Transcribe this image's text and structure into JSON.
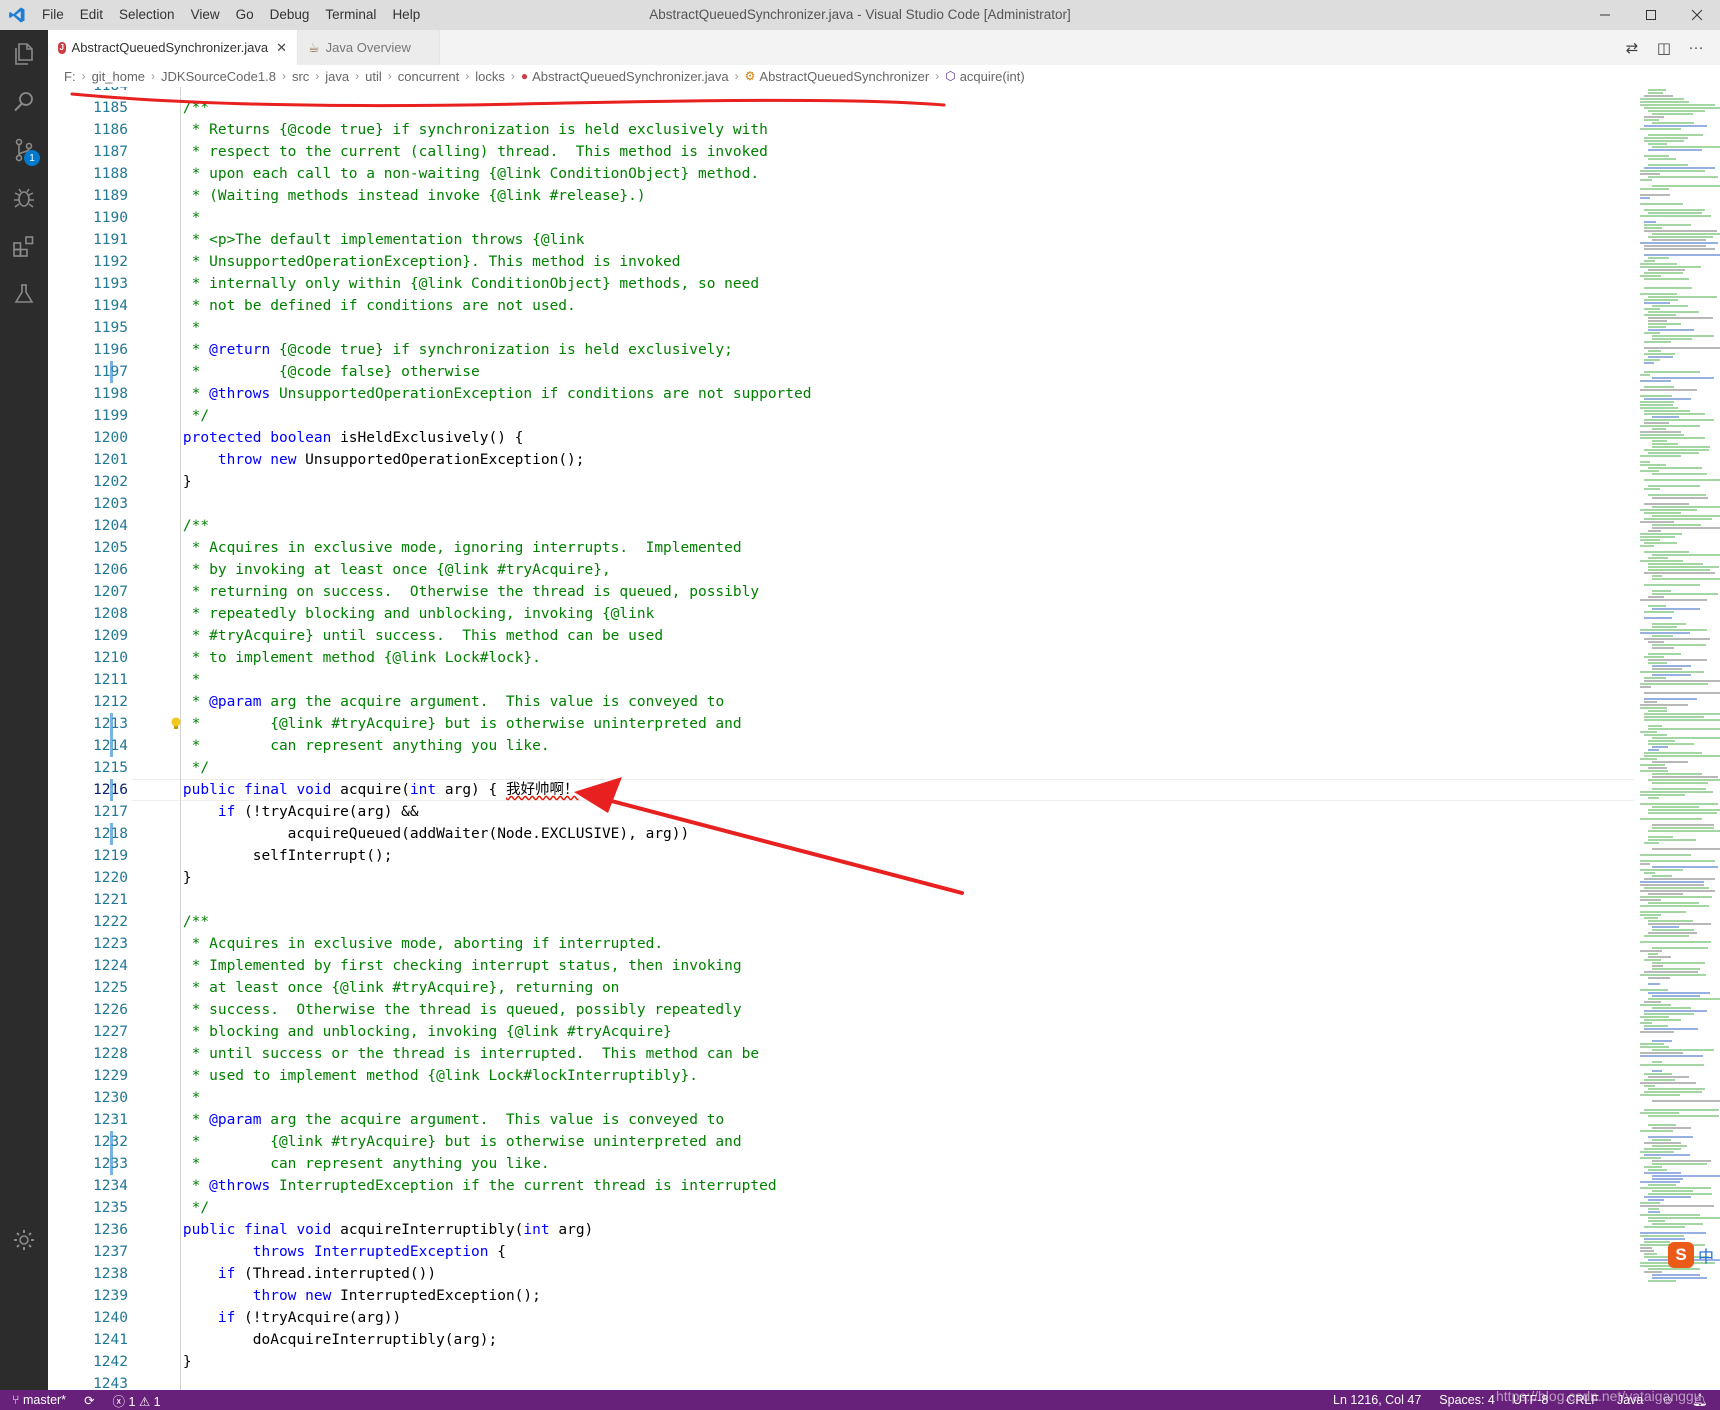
{
  "window": {
    "title": "AbstractQueuedSynchronizer.java - Visual Studio Code [Administrator]",
    "menu": [
      "File",
      "Edit",
      "Selection",
      "View",
      "Go",
      "Debug",
      "Terminal",
      "Help"
    ],
    "controls": [
      "minimize",
      "maximize",
      "close"
    ]
  },
  "activity_bar": {
    "items": [
      {
        "name": "explorer-icon"
      },
      {
        "name": "search-icon"
      },
      {
        "name": "source-control-icon",
        "badge": "1"
      },
      {
        "name": "debug-icon"
      },
      {
        "name": "extensions-icon"
      },
      {
        "name": "test-flask-icon"
      }
    ],
    "manage": "gear-icon"
  },
  "tabs": [
    {
      "label": "AbstractQueuedSynchronizer.java",
      "active": true,
      "icon": "java-file-icon"
    },
    {
      "label": "Java Overview",
      "active": false,
      "icon": "java-overview-icon"
    }
  ],
  "breadcrumb": [
    "F:",
    "git_home",
    "JDKSourceCode1.8",
    "src",
    "java",
    "util",
    "concurrent",
    "locks",
    "AbstractQueuedSynchronizer.java",
    "AbstractQueuedSynchronizer",
    "acquire(int)"
  ],
  "editor": {
    "first_line_partial": "1184",
    "current_line": 1216,
    "lines": [
      {
        "n": "1185",
        "t": [
          [
            "cm",
            "    /**"
          ]
        ]
      },
      {
        "n": "1186",
        "t": [
          [
            "cm",
            "     * Returns {@code true} if synchronization is held exclusively with"
          ]
        ]
      },
      {
        "n": "1187",
        "t": [
          [
            "cm",
            "     * respect to the current (calling) thread.  This method is invoked"
          ]
        ]
      },
      {
        "n": "1188",
        "t": [
          [
            "cm",
            "     * upon each call to a non-waiting {@link ConditionObject} method."
          ]
        ]
      },
      {
        "n": "1189",
        "t": [
          [
            "cm",
            "     * (Waiting methods instead invoke {@link #release}.)"
          ]
        ]
      },
      {
        "n": "1190",
        "t": [
          [
            "cm",
            "     *"
          ]
        ]
      },
      {
        "n": "1191",
        "t": [
          [
            "cm",
            "     * <p>The default implementation throws {@link"
          ]
        ]
      },
      {
        "n": "1192",
        "t": [
          [
            "cm",
            "     * UnsupportedOperationException}. This method is invoked"
          ]
        ]
      },
      {
        "n": "1193",
        "t": [
          [
            "cm",
            "     * internally only within {@link ConditionObject} methods, so need"
          ]
        ]
      },
      {
        "n": "1194",
        "t": [
          [
            "cm",
            "     * not be defined if conditions are not used."
          ]
        ]
      },
      {
        "n": "1195",
        "t": [
          [
            "cm",
            "     *"
          ]
        ]
      },
      {
        "n": "1196",
        "t": [
          [
            "cm",
            "     * "
          ],
          [
            "tag",
            "@return"
          ],
          [
            "cm",
            " {@code true} if synchronization is held exclusively;"
          ]
        ]
      },
      {
        "n": "1197",
        "t": [
          [
            "cm",
            "     *         {@code false} otherwise"
          ]
        ]
      },
      {
        "n": "1198",
        "t": [
          [
            "cm",
            "     * "
          ],
          [
            "tag",
            "@throws"
          ],
          [
            "cm",
            " UnsupportedOperationException if conditions are not supported"
          ]
        ]
      },
      {
        "n": "1199",
        "t": [
          [
            "cm",
            "     */"
          ]
        ]
      },
      {
        "n": "1200",
        "t": [
          [
            "kw",
            "    protected"
          ],
          [
            "pl",
            " "
          ],
          [
            "kw",
            "boolean"
          ],
          [
            "pl",
            " isHeldExclusively() {"
          ]
        ]
      },
      {
        "n": "1201",
        "t": [
          [
            "kw",
            "        throw"
          ],
          [
            "pl",
            " "
          ],
          [
            "kw",
            "new"
          ],
          [
            "pl",
            " UnsupportedOperationException();"
          ]
        ]
      },
      {
        "n": "1202",
        "t": [
          [
            "pl",
            "    }"
          ]
        ]
      },
      {
        "n": "1203",
        "t": []
      },
      {
        "n": "1204",
        "t": [
          [
            "cm",
            "    /**"
          ]
        ]
      },
      {
        "n": "1205",
        "t": [
          [
            "cm",
            "     * Acquires in exclusive mode, ignoring interrupts.  Implemented"
          ]
        ]
      },
      {
        "n": "1206",
        "t": [
          [
            "cm",
            "     * by invoking at least once {@link #tryAcquire},"
          ]
        ]
      },
      {
        "n": "1207",
        "t": [
          [
            "cm",
            "     * returning on success.  Otherwise the thread is queued, possibly"
          ]
        ]
      },
      {
        "n": "1208",
        "t": [
          [
            "cm",
            "     * repeatedly blocking and unblocking, invoking {@link"
          ]
        ]
      },
      {
        "n": "1209",
        "t": [
          [
            "cm",
            "     * #tryAcquire} until success.  This method can be used"
          ]
        ]
      },
      {
        "n": "1210",
        "t": [
          [
            "cm",
            "     * to implement method {@link Lock#lock}."
          ]
        ]
      },
      {
        "n": "1211",
        "t": [
          [
            "cm",
            "     *"
          ]
        ]
      },
      {
        "n": "1212",
        "t": [
          [
            "cm",
            "     * "
          ],
          [
            "tag",
            "@param"
          ],
          [
            "cm",
            " arg the acquire argument.  This value is conveyed to"
          ]
        ]
      },
      {
        "n": "1213",
        "t": [
          [
            "cm",
            "     *        {@link #tryAcquire} but is otherwise uninterpreted and"
          ]
        ]
      },
      {
        "n": "1214",
        "t": [
          [
            "cm",
            "     *        can represent anything you like."
          ]
        ]
      },
      {
        "n": "1215",
        "t": [
          [
            "cm",
            "     */"
          ]
        ]
      },
      {
        "n": "1216",
        "t": [
          [
            "kw",
            "    public"
          ],
          [
            "pl",
            " "
          ],
          [
            "kw",
            "final"
          ],
          [
            "pl",
            " "
          ],
          [
            "kw",
            "void"
          ],
          [
            "pl",
            " acquire("
          ],
          [
            "kw",
            "int"
          ],
          [
            "pl",
            " arg) { "
          ],
          [
            "cn",
            "我好帅啊！"
          ]
        ]
      },
      {
        "n": "1217",
        "t": [
          [
            "kw",
            "        if"
          ],
          [
            "pl",
            " (!tryAcquire(arg) &&"
          ]
        ]
      },
      {
        "n": "1218",
        "t": [
          [
            "pl",
            "                acquireQueued(addWaiter(Node.EXCLUSIVE), arg))"
          ]
        ]
      },
      {
        "n": "1219",
        "t": [
          [
            "pl",
            "            selfInterrupt();"
          ]
        ]
      },
      {
        "n": "1220",
        "t": [
          [
            "pl",
            "    }"
          ]
        ]
      },
      {
        "n": "1221",
        "t": []
      },
      {
        "n": "1222",
        "t": [
          [
            "cm",
            "    /**"
          ]
        ]
      },
      {
        "n": "1223",
        "t": [
          [
            "cm",
            "     * Acquires in exclusive mode, aborting if interrupted."
          ]
        ]
      },
      {
        "n": "1224",
        "t": [
          [
            "cm",
            "     * Implemented by first checking interrupt status, then invoking"
          ]
        ]
      },
      {
        "n": "1225",
        "t": [
          [
            "cm",
            "     * at least once {@link #tryAcquire}, returning on"
          ]
        ]
      },
      {
        "n": "1226",
        "t": [
          [
            "cm",
            "     * success.  Otherwise the thread is queued, possibly repeatedly"
          ]
        ]
      },
      {
        "n": "1227",
        "t": [
          [
            "cm",
            "     * blocking and unblocking, invoking {@link #tryAcquire}"
          ]
        ]
      },
      {
        "n": "1228",
        "t": [
          [
            "cm",
            "     * until success or the thread is interrupted.  This method can be"
          ]
        ]
      },
      {
        "n": "1229",
        "t": [
          [
            "cm",
            "     * used to implement method {@link Lock#lockInterruptibly}."
          ]
        ]
      },
      {
        "n": "1230",
        "t": [
          [
            "cm",
            "     *"
          ]
        ]
      },
      {
        "n": "1231",
        "t": [
          [
            "cm",
            "     * "
          ],
          [
            "tag",
            "@param"
          ],
          [
            "cm",
            " arg the acquire argument.  This value is conveyed to"
          ]
        ]
      },
      {
        "n": "1232",
        "t": [
          [
            "cm",
            "     *        {@link #tryAcquire} but is otherwise uninterpreted and"
          ]
        ]
      },
      {
        "n": "1233",
        "t": [
          [
            "cm",
            "     *        can represent anything you like."
          ]
        ]
      },
      {
        "n": "1234",
        "t": [
          [
            "cm",
            "     * "
          ],
          [
            "tag",
            "@throws"
          ],
          [
            "cm",
            " InterruptedException if the current thread is interrupted"
          ]
        ]
      },
      {
        "n": "1235",
        "t": [
          [
            "cm",
            "     */"
          ]
        ]
      },
      {
        "n": "1236",
        "t": [
          [
            "kw",
            "    public"
          ],
          [
            "pl",
            " "
          ],
          [
            "kw",
            "final"
          ],
          [
            "pl",
            " "
          ],
          [
            "kw",
            "void"
          ],
          [
            "pl",
            " acquireInterruptibly("
          ],
          [
            "kw",
            "int"
          ],
          [
            "pl",
            " arg)"
          ]
        ]
      },
      {
        "n": "1237",
        "t": [
          [
            "kw",
            "            throws"
          ],
          [
            "pl",
            " "
          ],
          [
            "ty",
            "InterruptedException"
          ],
          [
            "pl",
            " {"
          ]
        ]
      },
      {
        "n": "1238",
        "t": [
          [
            "kw",
            "        if"
          ],
          [
            "pl",
            " (Thread.interrupted())"
          ]
        ]
      },
      {
        "n": "1239",
        "t": [
          [
            "kw",
            "            throw"
          ],
          [
            "pl",
            " "
          ],
          [
            "kw",
            "new"
          ],
          [
            "pl",
            " InterruptedException();"
          ]
        ]
      },
      {
        "n": "1240",
        "t": [
          [
            "kw",
            "        if"
          ],
          [
            "pl",
            " (!tryAcquire(arg))"
          ]
        ]
      },
      {
        "n": "1241",
        "t": [
          [
            "pl",
            "            doAcquireInterruptibly(arg);"
          ]
        ]
      },
      {
        "n": "1242",
        "t": [
          [
            "pl",
            "    }"
          ]
        ]
      },
      {
        "n": "1243",
        "t": []
      }
    ],
    "modified_lines": [
      "1197",
      "1213",
      "1214",
      "1216",
      "1218",
      "1232",
      "1233"
    ]
  },
  "ime": {
    "logo": "S",
    "mode": "中"
  },
  "status_bar": {
    "branch": "master*",
    "sync_icon": "sync-icon",
    "errors": "1",
    "warnings": "1",
    "position": "Ln 1216, Col 47",
    "spaces": "Spaces: 4",
    "encoding": "UTF-8",
    "eol": "CRLF",
    "language": "Java",
    "watermark": "https://blog.csdn.net/yataiganggu"
  },
  "colors": {
    "statusbar": "#68217a",
    "activitybar": "#2c2c2c",
    "comment": "#008000",
    "keyword": "#0000ff",
    "line_number": "#237893",
    "annotation_red": "#e8201f"
  }
}
